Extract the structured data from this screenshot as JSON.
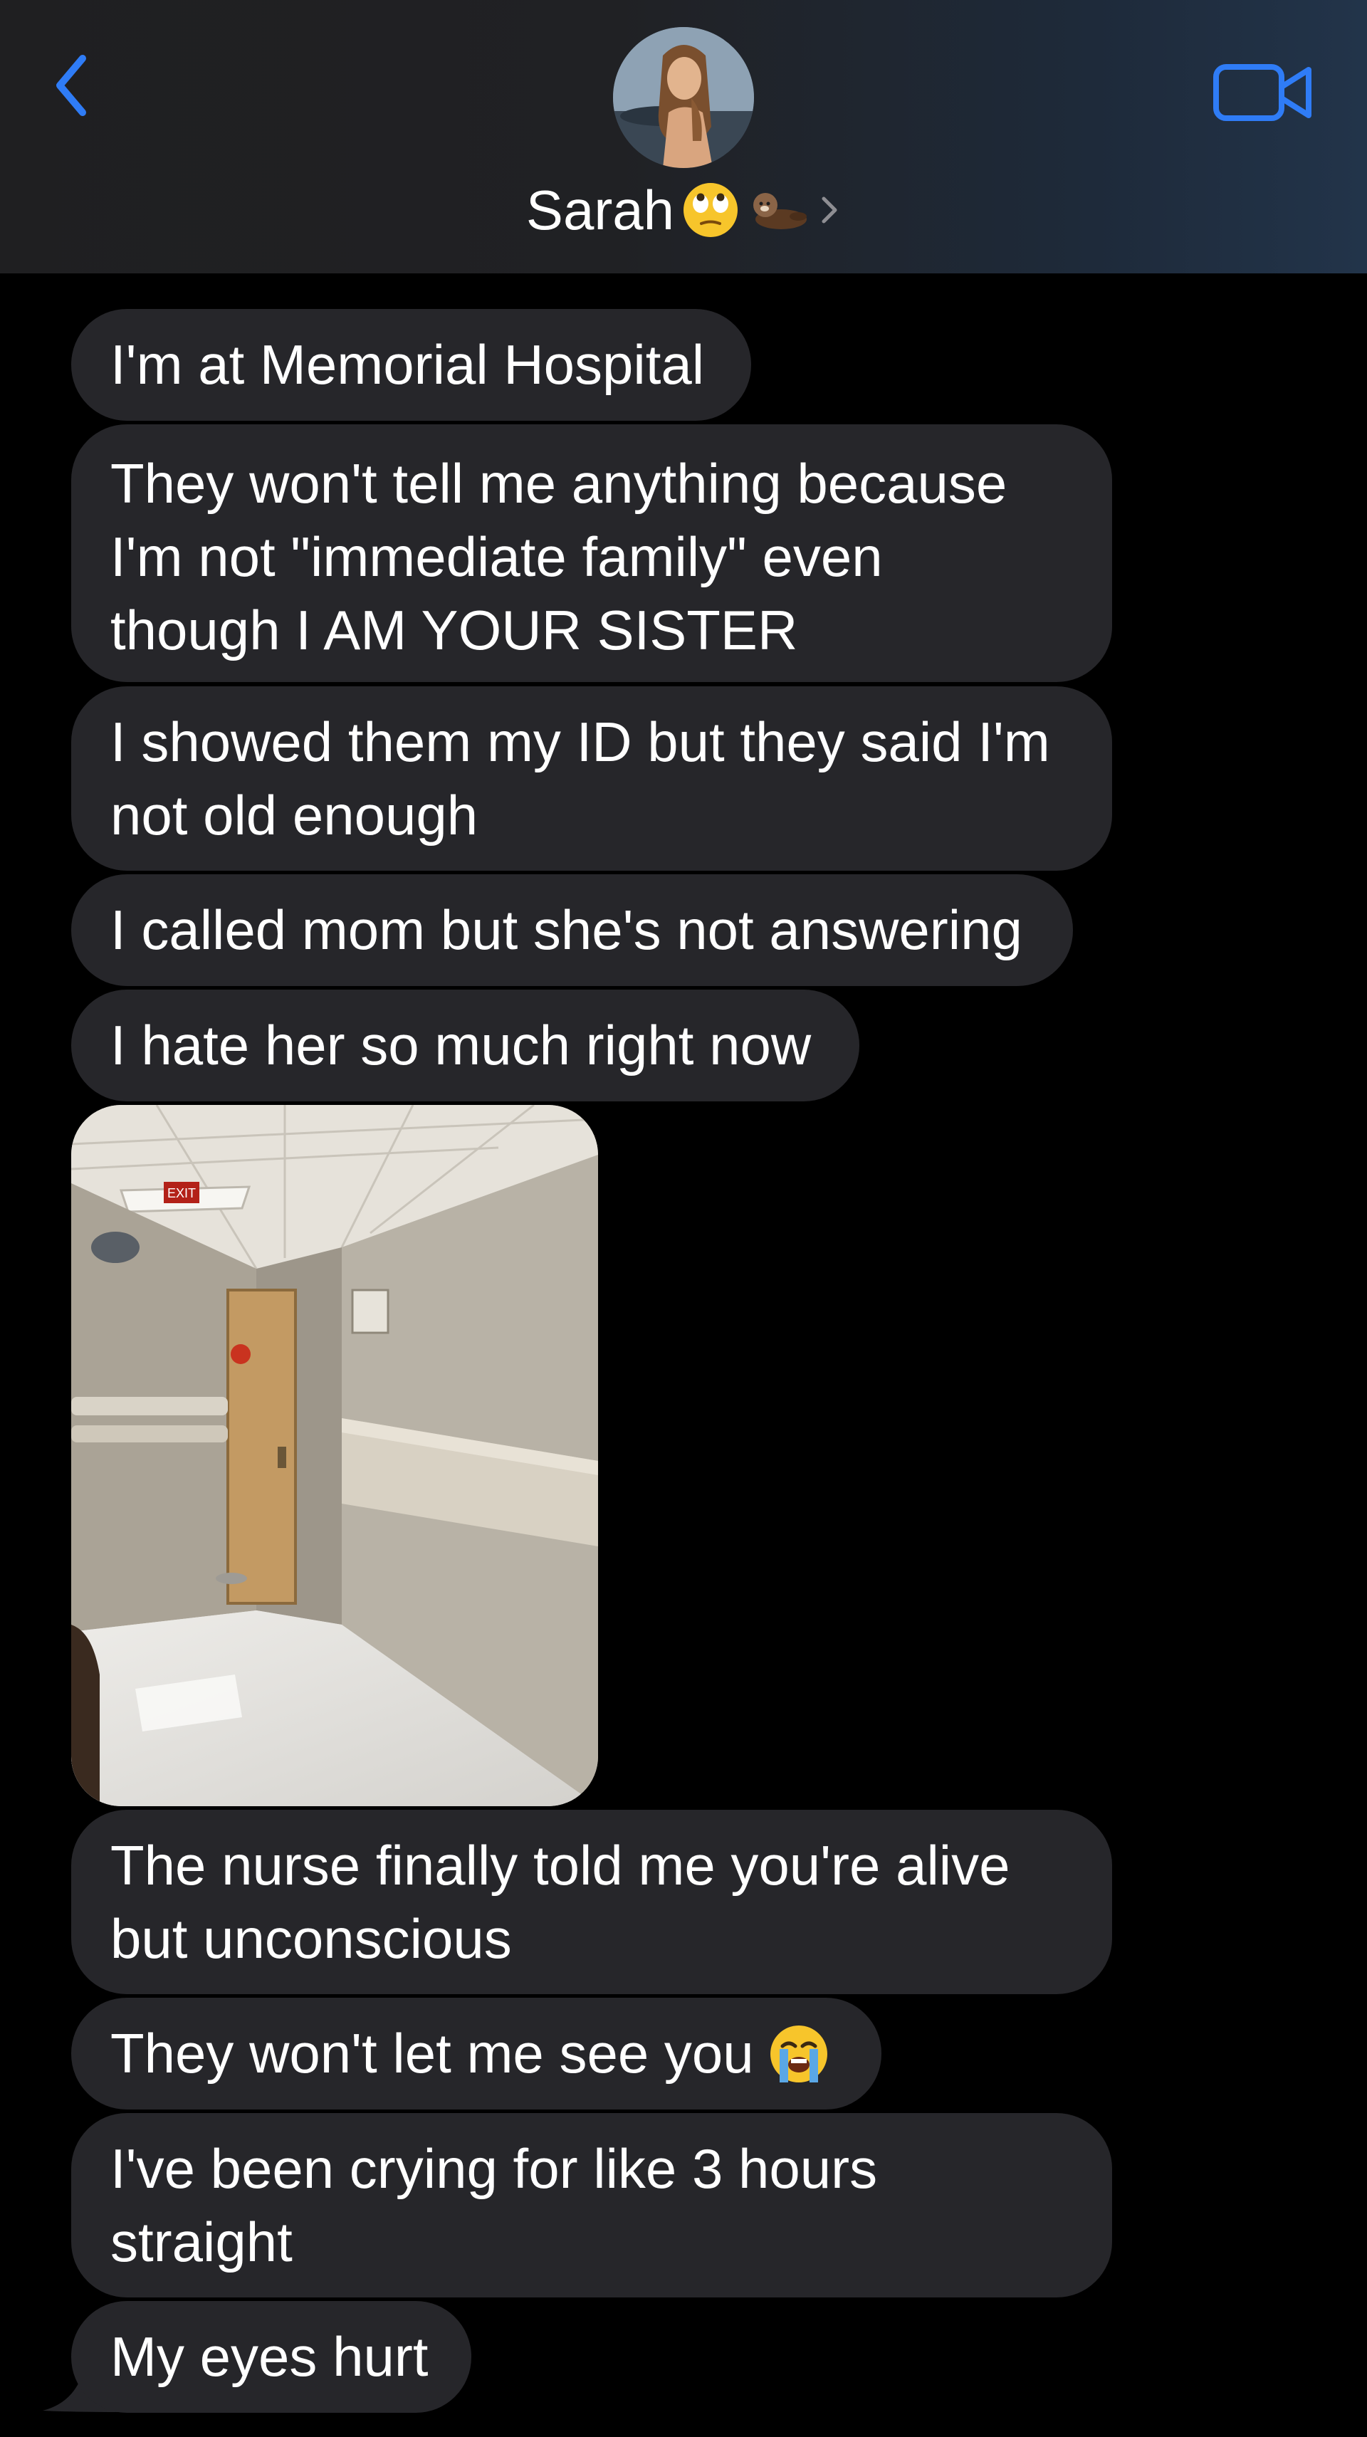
{
  "header": {
    "back_icon": "chevron-left-icon",
    "video_icon": "video-camera-icon",
    "contact_name": "Sarah",
    "contact_emojis": [
      "face-with-rolling-eyes",
      "otter"
    ],
    "accent_color": "#2f7cf6"
  },
  "messages": [
    {
      "text": "I'm at Memorial Hospital"
    },
    {
      "lines": [
        "They won't tell me anything because",
        "I'm not \"immediate family\" even",
        "though I AM YOUR SISTER"
      ]
    },
    {
      "lines": [
        "I showed them my ID but they said I'm",
        "not old enough"
      ]
    },
    {
      "text": "I called mom but she's not answering"
    },
    {
      "text": "I hate her so much right now"
    },
    {
      "type": "image",
      "alt": "hospital hallway photo"
    },
    {
      "lines": [
        "The nurse finally told me you're alive",
        "but unconscious"
      ]
    },
    {
      "text": "They won't let me see you",
      "emoji": "loudly-crying-face"
    },
    {
      "lines": [
        "I've been crying for like 3 hours",
        "straight"
      ]
    },
    {
      "text": "My eyes hurt"
    }
  ],
  "photo_sign": "EXIT",
  "colors": {
    "bubble": "#26262a",
    "background": "#000000",
    "text": "#ffffff"
  }
}
